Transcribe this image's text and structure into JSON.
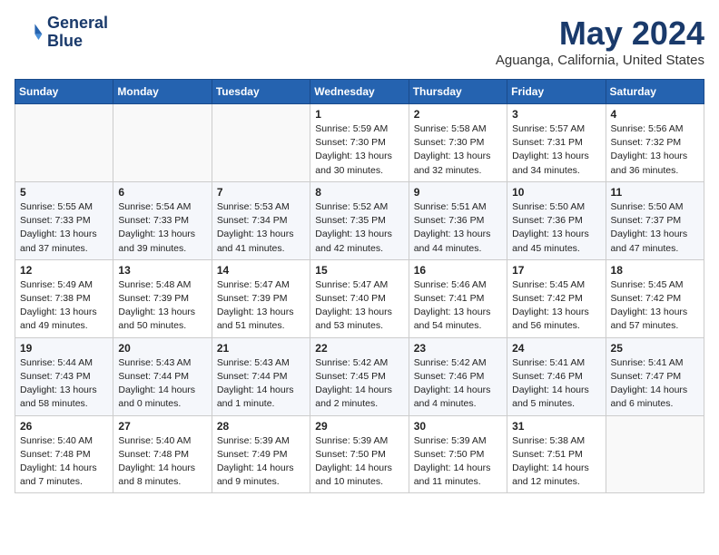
{
  "header": {
    "logo_line1": "General",
    "logo_line2": "Blue",
    "month_title": "May 2024",
    "location": "Aguanga, California, United States"
  },
  "weekdays": [
    "Sunday",
    "Monday",
    "Tuesday",
    "Wednesday",
    "Thursday",
    "Friday",
    "Saturday"
  ],
  "weeks": [
    [
      {
        "day": "",
        "sunrise": "",
        "sunset": "",
        "daylight": ""
      },
      {
        "day": "",
        "sunrise": "",
        "sunset": "",
        "daylight": ""
      },
      {
        "day": "",
        "sunrise": "",
        "sunset": "",
        "daylight": ""
      },
      {
        "day": "1",
        "sunrise": "Sunrise: 5:59 AM",
        "sunset": "Sunset: 7:30 PM",
        "daylight": "Daylight: 13 hours and 30 minutes."
      },
      {
        "day": "2",
        "sunrise": "Sunrise: 5:58 AM",
        "sunset": "Sunset: 7:30 PM",
        "daylight": "Daylight: 13 hours and 32 minutes."
      },
      {
        "day": "3",
        "sunrise": "Sunrise: 5:57 AM",
        "sunset": "Sunset: 7:31 PM",
        "daylight": "Daylight: 13 hours and 34 minutes."
      },
      {
        "day": "4",
        "sunrise": "Sunrise: 5:56 AM",
        "sunset": "Sunset: 7:32 PM",
        "daylight": "Daylight: 13 hours and 36 minutes."
      }
    ],
    [
      {
        "day": "5",
        "sunrise": "Sunrise: 5:55 AM",
        "sunset": "Sunset: 7:33 PM",
        "daylight": "Daylight: 13 hours and 37 minutes."
      },
      {
        "day": "6",
        "sunrise": "Sunrise: 5:54 AM",
        "sunset": "Sunset: 7:33 PM",
        "daylight": "Daylight: 13 hours and 39 minutes."
      },
      {
        "day": "7",
        "sunrise": "Sunrise: 5:53 AM",
        "sunset": "Sunset: 7:34 PM",
        "daylight": "Daylight: 13 hours and 41 minutes."
      },
      {
        "day": "8",
        "sunrise": "Sunrise: 5:52 AM",
        "sunset": "Sunset: 7:35 PM",
        "daylight": "Daylight: 13 hours and 42 minutes."
      },
      {
        "day": "9",
        "sunrise": "Sunrise: 5:51 AM",
        "sunset": "Sunset: 7:36 PM",
        "daylight": "Daylight: 13 hours and 44 minutes."
      },
      {
        "day": "10",
        "sunrise": "Sunrise: 5:50 AM",
        "sunset": "Sunset: 7:36 PM",
        "daylight": "Daylight: 13 hours and 45 minutes."
      },
      {
        "day": "11",
        "sunrise": "Sunrise: 5:50 AM",
        "sunset": "Sunset: 7:37 PM",
        "daylight": "Daylight: 13 hours and 47 minutes."
      }
    ],
    [
      {
        "day": "12",
        "sunrise": "Sunrise: 5:49 AM",
        "sunset": "Sunset: 7:38 PM",
        "daylight": "Daylight: 13 hours and 49 minutes."
      },
      {
        "day": "13",
        "sunrise": "Sunrise: 5:48 AM",
        "sunset": "Sunset: 7:39 PM",
        "daylight": "Daylight: 13 hours and 50 minutes."
      },
      {
        "day": "14",
        "sunrise": "Sunrise: 5:47 AM",
        "sunset": "Sunset: 7:39 PM",
        "daylight": "Daylight: 13 hours and 51 minutes."
      },
      {
        "day": "15",
        "sunrise": "Sunrise: 5:47 AM",
        "sunset": "Sunset: 7:40 PM",
        "daylight": "Daylight: 13 hours and 53 minutes."
      },
      {
        "day": "16",
        "sunrise": "Sunrise: 5:46 AM",
        "sunset": "Sunset: 7:41 PM",
        "daylight": "Daylight: 13 hours and 54 minutes."
      },
      {
        "day": "17",
        "sunrise": "Sunrise: 5:45 AM",
        "sunset": "Sunset: 7:42 PM",
        "daylight": "Daylight: 13 hours and 56 minutes."
      },
      {
        "day": "18",
        "sunrise": "Sunrise: 5:45 AM",
        "sunset": "Sunset: 7:42 PM",
        "daylight": "Daylight: 13 hours and 57 minutes."
      }
    ],
    [
      {
        "day": "19",
        "sunrise": "Sunrise: 5:44 AM",
        "sunset": "Sunset: 7:43 PM",
        "daylight": "Daylight: 13 hours and 58 minutes."
      },
      {
        "day": "20",
        "sunrise": "Sunrise: 5:43 AM",
        "sunset": "Sunset: 7:44 PM",
        "daylight": "Daylight: 14 hours and 0 minutes."
      },
      {
        "day": "21",
        "sunrise": "Sunrise: 5:43 AM",
        "sunset": "Sunset: 7:44 PM",
        "daylight": "Daylight: 14 hours and 1 minute."
      },
      {
        "day": "22",
        "sunrise": "Sunrise: 5:42 AM",
        "sunset": "Sunset: 7:45 PM",
        "daylight": "Daylight: 14 hours and 2 minutes."
      },
      {
        "day": "23",
        "sunrise": "Sunrise: 5:42 AM",
        "sunset": "Sunset: 7:46 PM",
        "daylight": "Daylight: 14 hours and 4 minutes."
      },
      {
        "day": "24",
        "sunrise": "Sunrise: 5:41 AM",
        "sunset": "Sunset: 7:46 PM",
        "daylight": "Daylight: 14 hours and 5 minutes."
      },
      {
        "day": "25",
        "sunrise": "Sunrise: 5:41 AM",
        "sunset": "Sunset: 7:47 PM",
        "daylight": "Daylight: 14 hours and 6 minutes."
      }
    ],
    [
      {
        "day": "26",
        "sunrise": "Sunrise: 5:40 AM",
        "sunset": "Sunset: 7:48 PM",
        "daylight": "Daylight: 14 hours and 7 minutes."
      },
      {
        "day": "27",
        "sunrise": "Sunrise: 5:40 AM",
        "sunset": "Sunset: 7:48 PM",
        "daylight": "Daylight: 14 hours and 8 minutes."
      },
      {
        "day": "28",
        "sunrise": "Sunrise: 5:39 AM",
        "sunset": "Sunset: 7:49 PM",
        "daylight": "Daylight: 14 hours and 9 minutes."
      },
      {
        "day": "29",
        "sunrise": "Sunrise: 5:39 AM",
        "sunset": "Sunset: 7:50 PM",
        "daylight": "Daylight: 14 hours and 10 minutes."
      },
      {
        "day": "30",
        "sunrise": "Sunrise: 5:39 AM",
        "sunset": "Sunset: 7:50 PM",
        "daylight": "Daylight: 14 hours and 11 minutes."
      },
      {
        "day": "31",
        "sunrise": "Sunrise: 5:38 AM",
        "sunset": "Sunset: 7:51 PM",
        "daylight": "Daylight: 14 hours and 12 minutes."
      },
      {
        "day": "",
        "sunrise": "",
        "sunset": "",
        "daylight": ""
      }
    ]
  ]
}
